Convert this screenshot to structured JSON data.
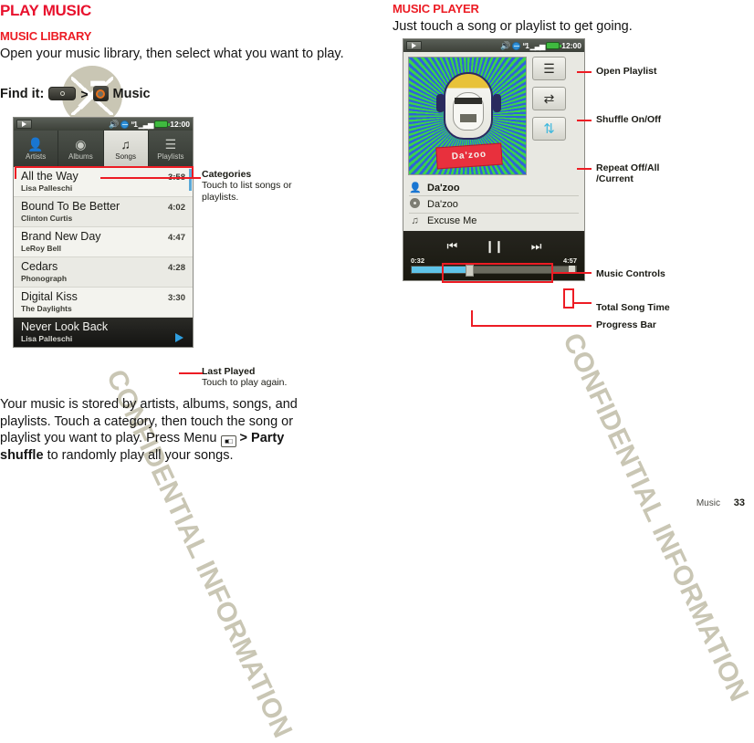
{
  "document": {
    "footer_section": "Music",
    "page_number": "33",
    "watermark_left": "CONFIDENTIAL INFORMATION",
    "watermark_right": "CONFIDENTIAL INFORMATION"
  },
  "left": {
    "h1": "PLAY MUSIC",
    "h2": "MUSIC LIBRARY",
    "intro": "Open your music library, then select what you want to play.",
    "find_it_label": "Find it:",
    "find_it_chevron": ">",
    "find_it_target": "Music",
    "body_before_menu": "Your music is stored by artists, albums, songs, and playlists. Touch a category, then touch the song or playlist you want to play. Press Menu",
    "body_menu_chevron": ">",
    "body_menu_bold": "Party shuffle",
    "body_after_menu": "to randomly play all your songs."
  },
  "right": {
    "h2": "MUSIC PLAYER",
    "intro": "Just touch a song or playlist to get going."
  },
  "library_phone": {
    "statusbar": {
      "speaker_icon": "speaker-icon",
      "globe_icon": "globe-icon",
      "bluetooth_icon": "bluetooth-icon",
      "signal_icon": "signal-bars-icon",
      "battery_icon": "battery-icon",
      "clock": "12:00"
    },
    "tabs": [
      {
        "label": "Artists",
        "glyph": "artist-icon",
        "active": false
      },
      {
        "label": "Albums",
        "glyph": "album-disc-icon",
        "active": false
      },
      {
        "label": "Songs",
        "glyph": "music-note-icon",
        "active": true
      },
      {
        "label": "Playlists",
        "glyph": "playlist-icon",
        "active": false
      }
    ],
    "songs": [
      {
        "title": "All the Way",
        "artist": "Lisa Palleschi",
        "duration": "3:58"
      },
      {
        "title": "Bound To Be Better",
        "artist": "Clinton Curtis",
        "duration": "4:02"
      },
      {
        "title": "Brand New Day",
        "artist": "LeRoy Bell",
        "duration": "4:47"
      },
      {
        "title": "Cedars",
        "artist": "Phonograph",
        "duration": "4:28"
      },
      {
        "title": "Digital Kiss",
        "artist": "The Daylights",
        "duration": "3:30"
      }
    ],
    "now_playing": {
      "title": "Never Look Back",
      "artist": "Lisa Palleschi"
    }
  },
  "player_phone": {
    "statusbar": {
      "clock": "12:00"
    },
    "album_art_text": "Da'zoo",
    "side_buttons": [
      {
        "name": "open-playlist-button",
        "glyph": "list-icon"
      },
      {
        "name": "shuffle-button",
        "glyph": "shuffle-icon"
      },
      {
        "name": "repeat-button",
        "glyph": "repeat-icon"
      }
    ],
    "meta": {
      "artist": "Da'zoo",
      "album": "Da'zoo",
      "track": "Excuse Me"
    },
    "controls": {
      "previous": "previous-track-button",
      "pause": "pause-button",
      "next": "next-track-button"
    },
    "elapsed_time": "0:32",
    "total_time": "4:57",
    "progress_percent": 35
  },
  "callouts": {
    "categories": {
      "title": "Categories",
      "desc": "Touch to list songs or playlists."
    },
    "last_played": {
      "title": "Last Played",
      "desc": "Touch to play again."
    },
    "open_playlist": {
      "title": "Open Playlist"
    },
    "shuffle": {
      "title": "Shuffle On/Off"
    },
    "repeat": {
      "title": "Repeat Off/All",
      "title2": "/Current"
    },
    "music_controls": {
      "title": "Music Controls"
    },
    "total_song_time": {
      "title": "Total Song Time"
    },
    "progress_bar": {
      "title": "Progress Bar"
    }
  },
  "colors": {
    "heading_red": "#ec1c24",
    "callout_red": "#ed1c24",
    "accent_blue": "#5fc3e8",
    "watermark": "#c9c6b4"
  }
}
